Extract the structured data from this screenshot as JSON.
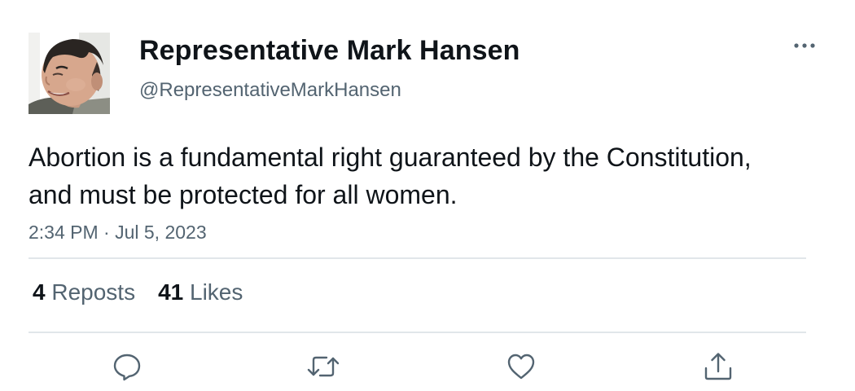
{
  "author": {
    "display_name": "Representative Mark Hansen",
    "handle": "@RepresentativeMarkHansen",
    "avatar": "profile-photo"
  },
  "tweet": {
    "text": "Abortion is a fundamental right guaranteed by the Constitution, and must be protected for all women.",
    "timestamp": "2:34 PM · Jul 5, 2023"
  },
  "stats": {
    "reposts_count": "4",
    "reposts_label": "Reposts",
    "likes_count": "41",
    "likes_label": "Likes"
  },
  "actions": [
    "reply-icon",
    "repost-icon",
    "like-icon",
    "share-icon"
  ],
  "more_menu_icon": "more-icon",
  "colors": {
    "text_primary": "#0f1419",
    "text_secondary": "#536471",
    "divider": "#e1e6ea",
    "icon": "#536471"
  }
}
